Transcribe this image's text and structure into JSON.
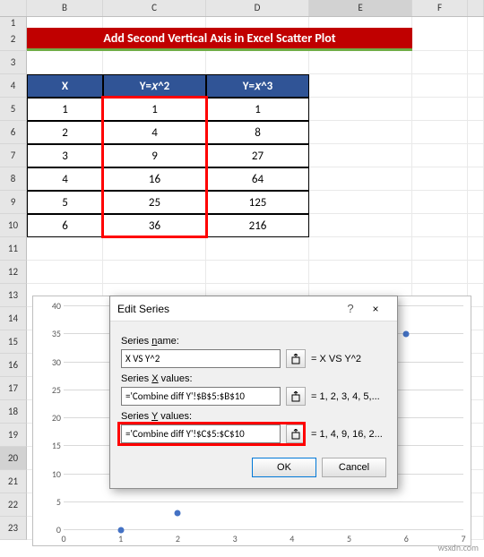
{
  "columns": [
    "",
    "B",
    "C",
    "D",
    "E",
    "F",
    ""
  ],
  "selected_col": "E",
  "title_banner": "Add Second  Vertical Axis in Excel Scatter Plot",
  "table": {
    "headers": {
      "x": "X",
      "y2": "Y=𝑥^2",
      "y3": "Y=𝑥^3"
    },
    "rows": [
      {
        "x": "1",
        "y2": "1",
        "y3": "1"
      },
      {
        "x": "2",
        "y2": "4",
        "y3": "8"
      },
      {
        "x": "3",
        "y2": "9",
        "y3": "27"
      },
      {
        "x": "4",
        "y2": "16",
        "y3": "64"
      },
      {
        "x": "5",
        "y2": "25",
        "y3": "125"
      },
      {
        "x": "6",
        "y2": "36",
        "y3": "216"
      }
    ]
  },
  "row_numbers": [
    "1",
    "2",
    "3",
    "4",
    "5",
    "6",
    "7",
    "8",
    "9",
    "10",
    "11",
    "12",
    "13",
    "14",
    "15",
    "16",
    "17",
    "18",
    "19",
    "20",
    "21",
    "22",
    "23"
  ],
  "dialog": {
    "title": "Edit Series",
    "help": "?",
    "close": "×",
    "labels": {
      "name": "Series name:",
      "x": "Series X values:",
      "y": "Series Y values:"
    },
    "values": {
      "name": "X VS Y^2",
      "x": "='Combine diff Y'!$B$5:$B$10",
      "y": "='Combine diff Y'!$C$5:$C$10"
    },
    "previews": {
      "name": "= X VS Y^2",
      "x": "= 1, 2, 3, 4, 5,...",
      "y": "= 1, 4, 9, 16, 2..."
    },
    "ok": "OK",
    "cancel": "Cancel"
  },
  "chart_data": {
    "type": "scatter",
    "x": [
      1,
      2,
      3,
      4,
      5,
      6
    ],
    "y": [
      1,
      4,
      9,
      16,
      25,
      36
    ],
    "xlabel": "",
    "ylabel": "",
    "xlim": [
      0,
      7
    ],
    "ylim": [
      0,
      40
    ],
    "xticks": [
      0,
      1,
      2,
      3,
      4,
      5,
      6,
      7
    ],
    "yticks": [
      0,
      5,
      10,
      15,
      20,
      25,
      30,
      35,
      40
    ]
  },
  "watermark": "wsxdn.com"
}
